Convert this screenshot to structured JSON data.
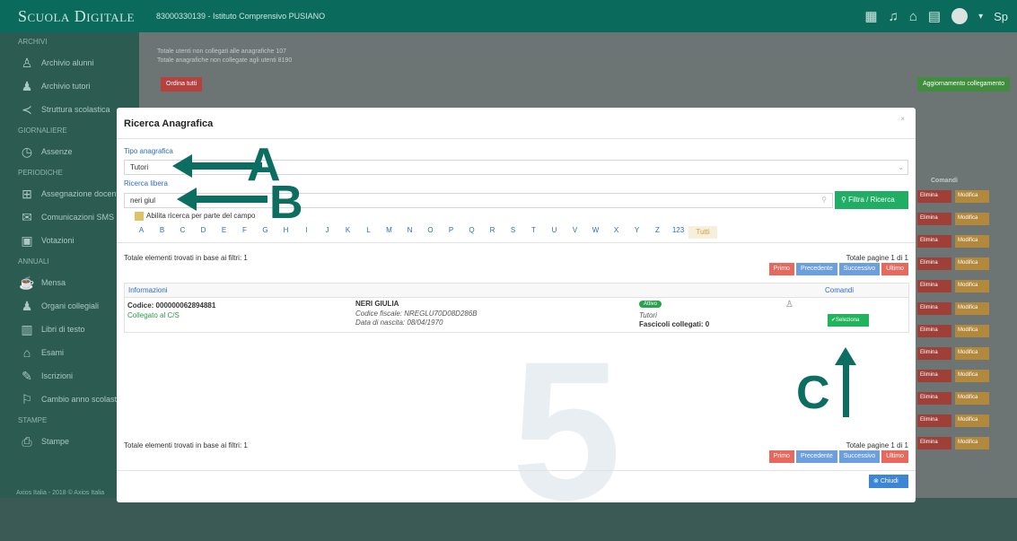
{
  "app": {
    "brand": "Scuola Digitale",
    "school": "83000330139 - Istituto Comprensivo PUSIANO",
    "user_initial": "Sp"
  },
  "sidebar": {
    "sections": [
      "Archivi",
      "Giornaliere",
      "Periodiche",
      "Annuali",
      "Stampe"
    ],
    "items": [
      "Archivio alunni",
      "Archivio tutori",
      "Struttura scolastica",
      "Assenze",
      "Assegnazione docenti",
      "Comunicazioni SMS",
      "Votazioni",
      "Mensa",
      "Organi collegiali",
      "Libri di testo",
      "Esami",
      "Iscrizioni",
      "Cambio anno scolastico",
      "Stampe"
    ],
    "footer": "Axios Italia - 2018 © Axios Italia"
  },
  "background": {
    "line1": "Totale utenti non collegati alle anagrafiche 107",
    "line2": "Totale anagrafiche non collegate agli utenti 8190",
    "btn_reset": "Ordina tutti",
    "btn_link": "Aggiornamento collegamento",
    "col_comandi": "Comandi",
    "row_btn1": "Elimina",
    "row_btn2": "Modifica"
  },
  "modal": {
    "title": "Ricerca Anagrafica",
    "close_x": "×",
    "tipo_label": "Tipo anagrafica",
    "tipo_value": "Tutori",
    "ricerca_label": "Ricerca libera",
    "ricerca_value": "neri giul",
    "filter_button": "Filtra / Ricerca",
    "checkbox_label": "Abilita ricerca per parte del campo",
    "alphabet": [
      "A",
      "B",
      "C",
      "D",
      "E",
      "F",
      "G",
      "H",
      "I",
      "J",
      "K",
      "L",
      "M",
      "N",
      "O",
      "P",
      "Q",
      "R",
      "S",
      "T",
      "U",
      "V",
      "W",
      "X",
      "Y",
      "Z",
      "123",
      "Tutti"
    ],
    "total_text": "Totale elementi trovati in base ai filtri: 1",
    "pages_text": "Totale pagine 1 di 1",
    "pag_primo": "Primo",
    "pag_prec": "Precedente",
    "pag_succ": "Successivo",
    "pag_ultimo": "Ultimo",
    "col_info": "Informazioni",
    "col_comandi": "Comandi",
    "row": {
      "codice": "Codice: 000000062894881",
      "collegato": "Collegato al C/S",
      "name": "NERI GIULIA",
      "cf": "Codice fiscale: NREGLU70D08D286B",
      "nascita": "Data di nascita: 08/04/1970",
      "badge": "Attivo",
      "tipo": "Tutori",
      "fascicoli": "Fascicoli collegati: 0",
      "select_btn": "Seleziona"
    },
    "big_number": "5",
    "close_button": "Chiudi"
  },
  "annotations": {
    "a": "A",
    "b": "B",
    "c": "C"
  },
  "colors": {
    "topbar": "#0a6a5b",
    "sidebar": "#2c5b52",
    "accent_green": "#1fae63",
    "accent_blue": "#3d86d6",
    "arrow": "#0b6e61",
    "danger": "#e8685e"
  }
}
